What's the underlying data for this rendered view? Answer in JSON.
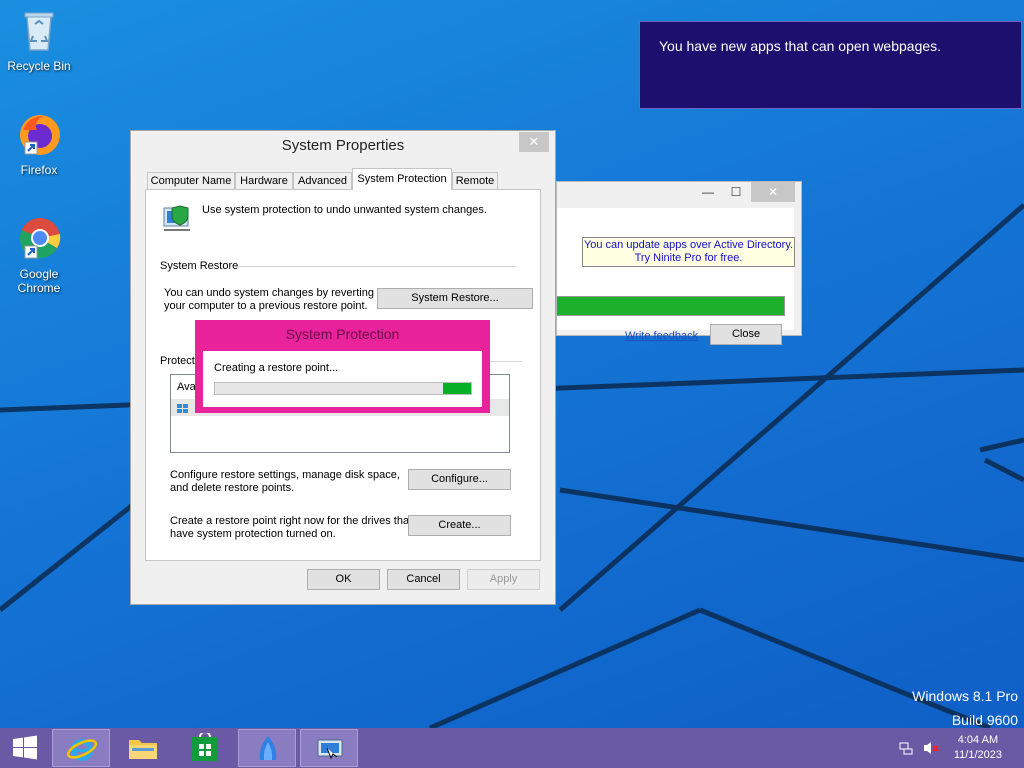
{
  "desktop": {
    "icons": [
      {
        "label": "Recycle Bin"
      },
      {
        "label": "Firefox"
      },
      {
        "label": "Google Chrome"
      }
    ],
    "watermark": {
      "line1": "Windows 8.1 Pro",
      "line2": "Build 9600"
    }
  },
  "notification": {
    "text": "You have new apps that can open webpages."
  },
  "ninite": {
    "message_line1": "You can update apps over Active Directory.",
    "message_line2": "Try Ninite Pro for free.",
    "progress_percent": 100,
    "feedback_link": "Write feedback",
    "close_label": "Close"
  },
  "system_properties": {
    "title": "System Properties",
    "tabs": [
      "Computer Name",
      "Hardware",
      "Advanced",
      "System Protection",
      "Remote"
    ],
    "active_tab": "System Protection",
    "intro": "Use system protection to undo unwanted system changes.",
    "restore_group": "System Restore",
    "restore_desc_1": "You can undo system changes by reverting",
    "restore_desc_2": "your computer to a previous restore point.",
    "restore_button": "System Restore...",
    "protection_group": "Protecti",
    "list_header": "Ava",
    "configure_desc_1": "Configure restore settings, manage disk space,",
    "configure_desc_2": "and delete restore points.",
    "configure_button": "Configure...",
    "create_desc_1": "Create a restore point right now for the drives that",
    "create_desc_2": "have system protection turned on.",
    "create_button": "Create...",
    "ok": "OK",
    "cancel": "Cancel",
    "apply": "Apply"
  },
  "system_protection_dialog": {
    "title": "System Protection",
    "message": "Creating a restore point...",
    "progress_segment_start": 0.89,
    "progress_segment_end": 1.0
  },
  "taskbar": {
    "clock_time": "4:04 AM",
    "clock_date": "11/1/2023",
    "items": [
      {
        "name": "internet-explorer"
      },
      {
        "name": "file-explorer"
      },
      {
        "name": "store"
      },
      {
        "name": "ninite"
      },
      {
        "name": "system-properties"
      }
    ]
  },
  "colors": {
    "taskbar": "#6a5aa6",
    "accent_pink": "#e8239b",
    "progress_green": "#06b025",
    "notification_bg": "#1c0f6e"
  }
}
